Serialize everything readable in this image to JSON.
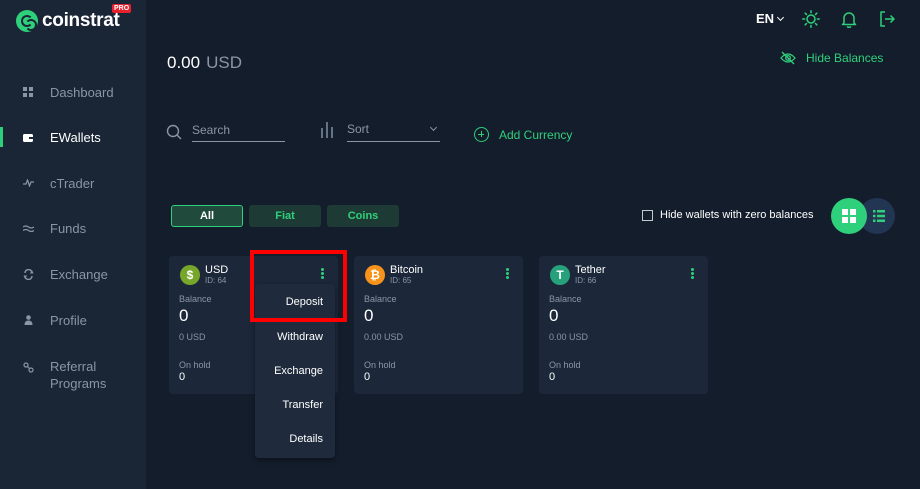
{
  "app": {
    "brand": "coinstrat",
    "brand_badge": "PRO",
    "accent": "#2fd07b"
  },
  "sidebar": {
    "items": [
      {
        "label": "Dashboard",
        "icon": "grid-icon",
        "active": false
      },
      {
        "label": "EWallets",
        "icon": "wallet-icon",
        "active": true
      },
      {
        "label": "cTrader",
        "icon": "chart-icon",
        "active": false
      },
      {
        "label": "Funds",
        "icon": "funds-icon",
        "active": false
      },
      {
        "label": "Exchange",
        "icon": "exchange-icon",
        "active": false
      },
      {
        "label": "Profile",
        "icon": "user-icon",
        "active": false
      },
      {
        "label": "Referral Programs",
        "icon": "referral-icon",
        "active": false
      }
    ]
  },
  "header": {
    "language": "EN",
    "total_balance": "0.00",
    "total_currency": "USD",
    "hide_balances": "Hide Balances"
  },
  "toolbar": {
    "search_placeholder": "Search",
    "sort_placeholder": "Sort",
    "add_currency": "Add Currency"
  },
  "filters": {
    "tabs": [
      {
        "label": "All",
        "active": true
      },
      {
        "label": "Fiat",
        "active": false
      },
      {
        "label": "Coins",
        "active": false
      }
    ],
    "hide_zero_label": "Hide wallets with zero balances",
    "hide_zero_checked": false
  },
  "wallets": [
    {
      "name": "USD",
      "id": "ID: 64",
      "coin_symbol": "$",
      "coin_color": "#76a72b",
      "balance_label": "Balance",
      "balance": "0",
      "balance_usd": "0 USD",
      "hold_label": "On hold",
      "hold": "0"
    },
    {
      "name": "Bitcoin",
      "id": "ID: 65",
      "coin_symbol": "₿",
      "coin_color": "#f7931a",
      "balance_label": "Balance",
      "balance": "0",
      "balance_usd": "0.00 USD",
      "hold_label": "On hold",
      "hold": "0"
    },
    {
      "name": "Tether",
      "id": "ID: 66",
      "coin_symbol": "T",
      "coin_color": "#26a17b",
      "balance_label": "Balance",
      "balance": "0",
      "balance_usd": "0.00 USD",
      "hold_label": "On hold",
      "hold": "0"
    }
  ],
  "wallet_menu": {
    "items": [
      "Deposit",
      "Withdraw",
      "Exchange",
      "Transfer",
      "Details"
    ]
  }
}
